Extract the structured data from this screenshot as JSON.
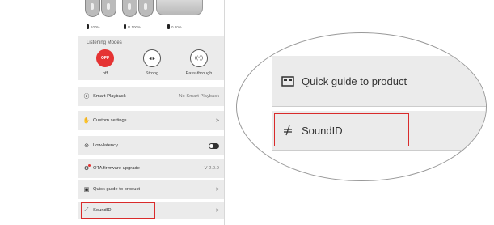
{
  "earbuds": {
    "left_battery": "100%",
    "right_battery": "R 100%",
    "case_battery": "0 80%"
  },
  "listening_modes": {
    "title": "Listening Modes",
    "modes": [
      {
        "icon_text": "OFF",
        "label": "off"
      },
      {
        "icon": "anc-strong-icon",
        "label": "Strong"
      },
      {
        "icon": "passthrough-icon",
        "label": "Pass-through"
      }
    ]
  },
  "settings": [
    {
      "icon": "smart-playback-icon",
      "label": "Smart Playback",
      "value": "No Smart Playback"
    },
    {
      "icon": "hand-icon",
      "label": "Custom settings",
      "value": ">"
    },
    {
      "icon": "game-controller-icon",
      "label": "Low-latency",
      "toggle": true
    },
    {
      "icon": "ota-icon",
      "label": "OTA firmware upgrade",
      "value": "V 2.0.9"
    },
    {
      "icon": "guide-icon",
      "label": "Quick guide to product",
      "value": ">"
    },
    {
      "icon": "soundid-icon",
      "label": "SoundID",
      "value": ">"
    }
  ],
  "zoom": {
    "items": [
      {
        "icon": "guide-icon",
        "label": "Quick guide to product"
      },
      {
        "icon": "soundid-icon",
        "label": "SoundID"
      }
    ]
  },
  "colors": {
    "accent": "#e53333",
    "highlight": "#d92b2b",
    "row_bg": "#ebebeb"
  }
}
